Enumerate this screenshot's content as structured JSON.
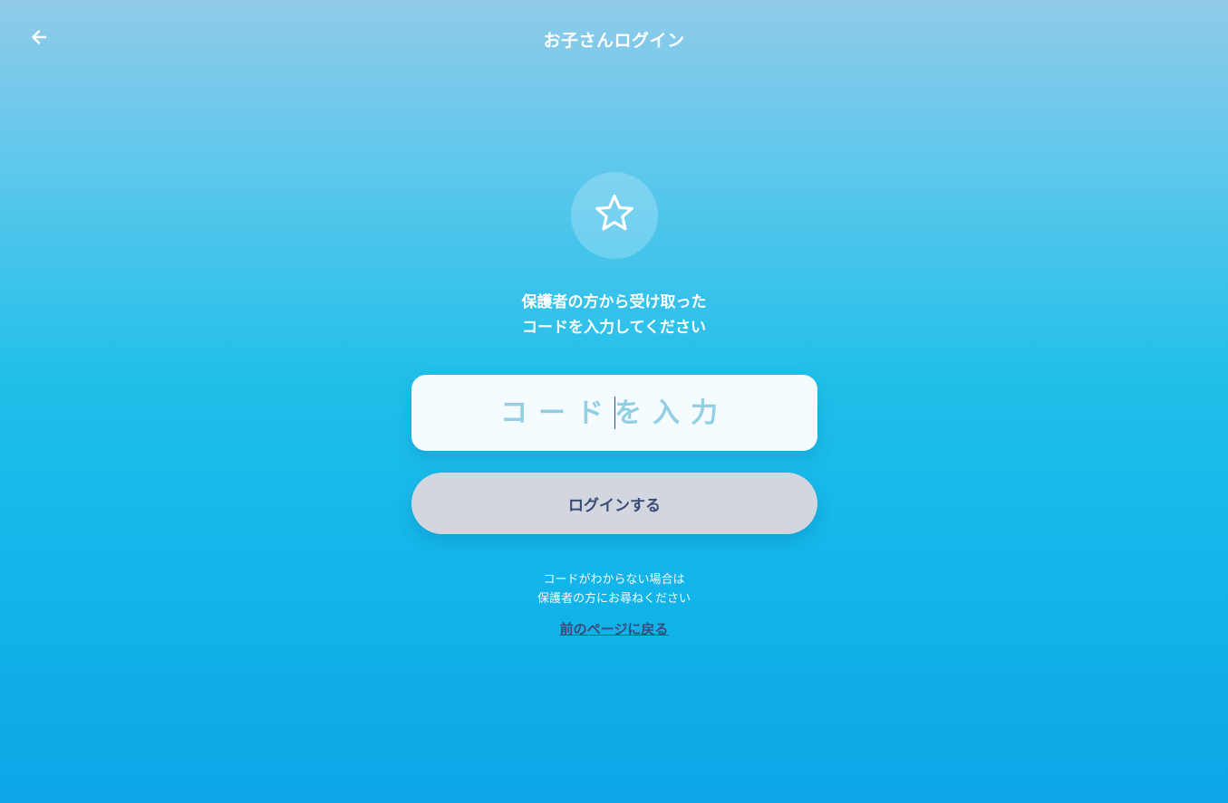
{
  "header": {
    "back_icon": "arrow-left-icon",
    "title": "お子さんログイン"
  },
  "badge": {
    "icon": "star-icon"
  },
  "instruction": {
    "line1": "保護者の方から受け取った",
    "line2": "コードを入力してください"
  },
  "code_input": {
    "value": "",
    "placeholder": "コードを入力"
  },
  "login_button": {
    "label": "ログインする"
  },
  "help": {
    "line1": "コードがわからない場合は",
    "line2": "保護者の方にお尋ねください"
  },
  "back_link": {
    "label": "前のページに戻る"
  },
  "colors": {
    "gradient_top": "#90cbe9",
    "gradient_bottom": "#0ea6e8",
    "input_bg": "#f4fcff",
    "placeholder": "#93cfe4",
    "button_bg": "#d2d6de",
    "button_text": "#3c4a78",
    "link_text": "#3c4a78"
  }
}
